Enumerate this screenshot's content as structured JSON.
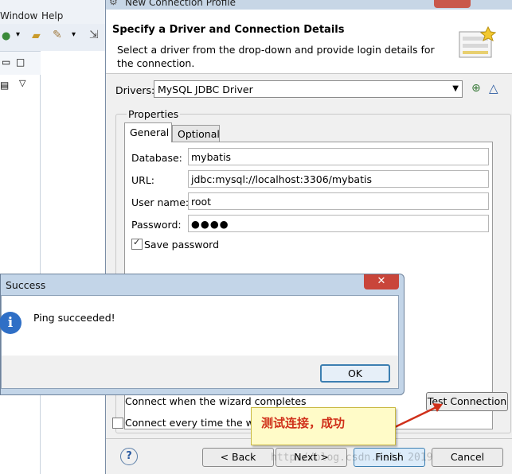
{
  "background": {
    "menus": [
      "Window",
      "Help"
    ]
  },
  "dialog": {
    "window_title": "New Connection Profile",
    "header_title": "Specify a Driver and Connection Details",
    "header_desc": "Select a driver from the drop-down and provide login details for the connection.",
    "drivers_label": "Drivers:",
    "drivers_value": "MySQL JDBC Driver",
    "properties_label": "Properties",
    "tabs": [
      "General",
      "Optional"
    ],
    "fields": {
      "database_label": "Database:",
      "database_value": "mybatis",
      "url_label": "URL:",
      "url_value": "jdbc:mysql://localhost:3306/mybatis",
      "username_label": "User name:",
      "username_value": "root",
      "password_label": "Password:",
      "password_value": "●●●●"
    },
    "save_password_label": "Save password",
    "save_password_checked": true,
    "connect_wizard_label": "Connect when the wizard completes",
    "connect_every_label": "Connect every time the wor",
    "test_connection_label": "Test Connection",
    "buttons": {
      "back": "< Back",
      "next": "Next >",
      "finish": "Finish",
      "cancel": "Cancel"
    }
  },
  "popup": {
    "title": "Success",
    "message": "Ping succeeded!",
    "ok_label": "OK",
    "close_glyph": "✕"
  },
  "annotation": {
    "text": "测试连接，成功",
    "color": "#d0301a"
  },
  "watermark": {
    "text": "http://blog.csdn.net/ 2019"
  },
  "colors": {
    "accent": "#3c7fb1",
    "dialog_bg": "#f0f0f0",
    "popup_frame": "#c3d5e8"
  }
}
